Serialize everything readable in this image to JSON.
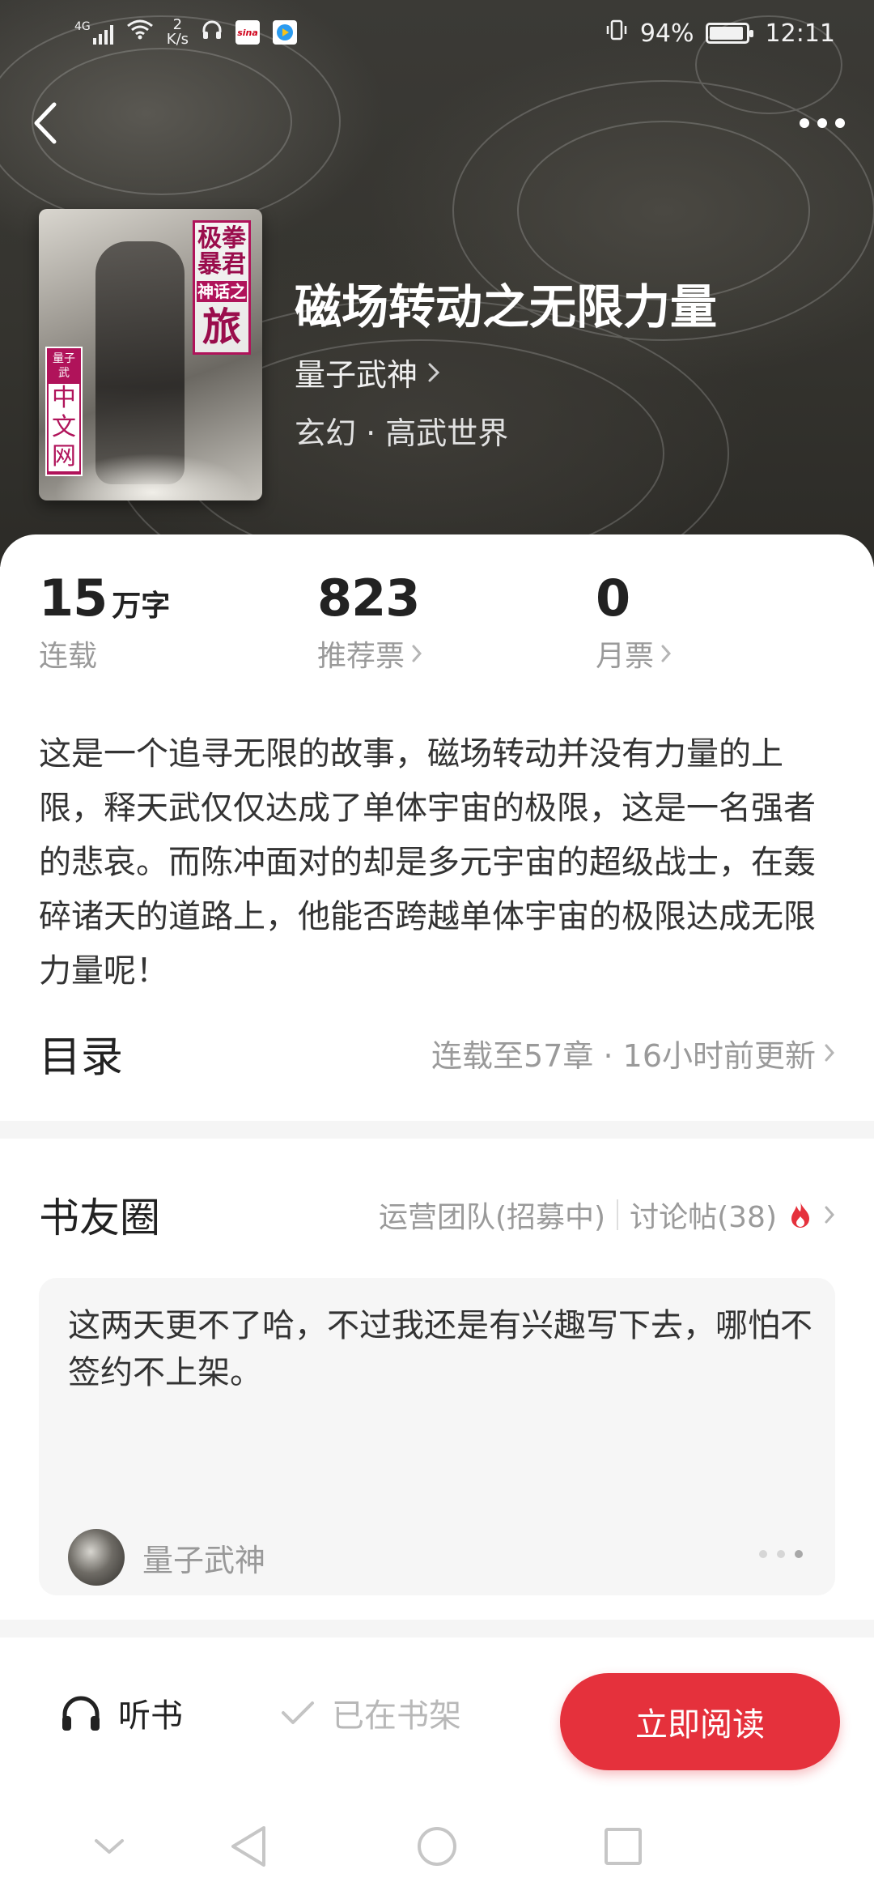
{
  "status_bar": {
    "signal": "4G",
    "net_speed_value": "2",
    "net_speed_unit": "K/s",
    "app_badge_1": "sina",
    "battery_percent": "94%",
    "battery_level": 0.94,
    "time": "12:11"
  },
  "book": {
    "title": "磁场转动之无限力量",
    "author": "量子武神",
    "genre": "玄幻 · 高武世界",
    "cover_text": {
      "top": "极拳暴君",
      "middle": "神话之",
      "bottom": "旅",
      "publisher_top": "量子武",
      "publisher_bottom": "中文网"
    }
  },
  "stats": {
    "words_number": "15",
    "words_unit": "万字",
    "words_label": "连载",
    "recommend_number": "823",
    "recommend_label": "推荐票",
    "monthly_number": "0",
    "monthly_label": "月票"
  },
  "description": "这是一个追寻无限的故事，磁场转动并没有力量的上限，释天武仅仅达成了单体宇宙的极限，这是一名强者的悲哀。而陈冲面对的却是多元宇宙的超级战士，在轰碎诸天的道路上，他能否跨越单体宇宙的极限达成无限力量呢！",
  "toc": {
    "title": "目录",
    "info": "连载至57章 · 16小时前更新"
  },
  "circle": {
    "title": "书友圈",
    "team_link": "运营团队(招募中)",
    "discussion_link": "讨论帖(38)",
    "post": {
      "text": "这两天更不了哈，不过我还是有兴趣写下去，哪怕不签约不上架。",
      "author": "量子武神"
    }
  },
  "actions": {
    "listen": "听书",
    "on_shelf": "已在书架",
    "read_now": "立即阅读"
  },
  "colors": {
    "accent": "#e5313c",
    "hero_bg": "#35342f",
    "fire": "#e5313c"
  }
}
